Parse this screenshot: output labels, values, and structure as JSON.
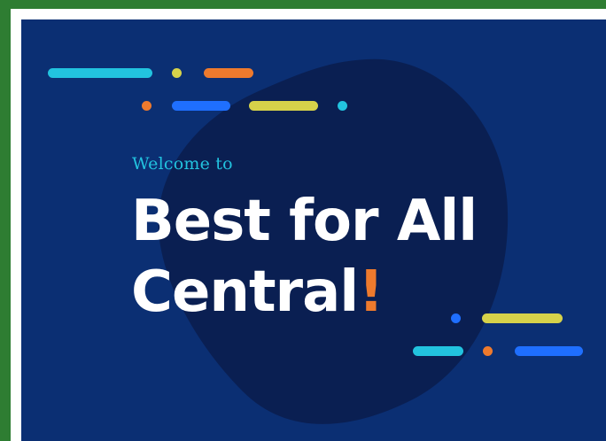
{
  "hero": {
    "welcome_text": "Welcome to",
    "title_line1": "Best for All",
    "title_line2": "Central",
    "title_punct": "!"
  },
  "colors": {
    "outer_border": "#2e7d32",
    "background": "#0b2f73",
    "blob": "#0a1f52",
    "cyan": "#22c3df",
    "orange": "#ee7a2d",
    "blue": "#1f6fff",
    "yellow": "#d6d24a",
    "title": "#ffffff"
  }
}
